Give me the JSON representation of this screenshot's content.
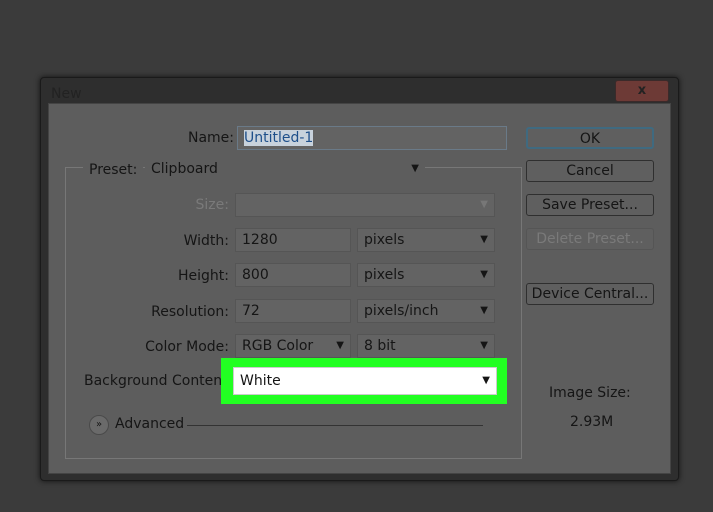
{
  "dialog": {
    "title": "New",
    "close_label": "x"
  },
  "form": {
    "name_label": "Name:",
    "name_value": "Untitled-1",
    "preset_label": "Preset:",
    "preset_value": "Clipboard",
    "size_label": "Size:",
    "size_value": "",
    "width_label": "Width:",
    "width_value": "1280",
    "width_unit": "pixels",
    "height_label": "Height:",
    "height_value": "800",
    "height_unit": "pixels",
    "resolution_label": "Resolution:",
    "resolution_value": "72",
    "resolution_unit": "pixels/inch",
    "color_mode_label": "Color Mode:",
    "color_mode_value": "RGB Color",
    "bit_depth": "8 bit",
    "background_label": "Background Contents:",
    "background_value": "White",
    "advanced_label": "Advanced"
  },
  "buttons": {
    "ok": "OK",
    "cancel": "Cancel",
    "save_preset": "Save Preset...",
    "delete_preset": "Delete Preset...",
    "device_central": "Device Central..."
  },
  "image_size": {
    "label": "Image Size:",
    "value": "2.93M"
  },
  "highlight_color": "#22ff22"
}
